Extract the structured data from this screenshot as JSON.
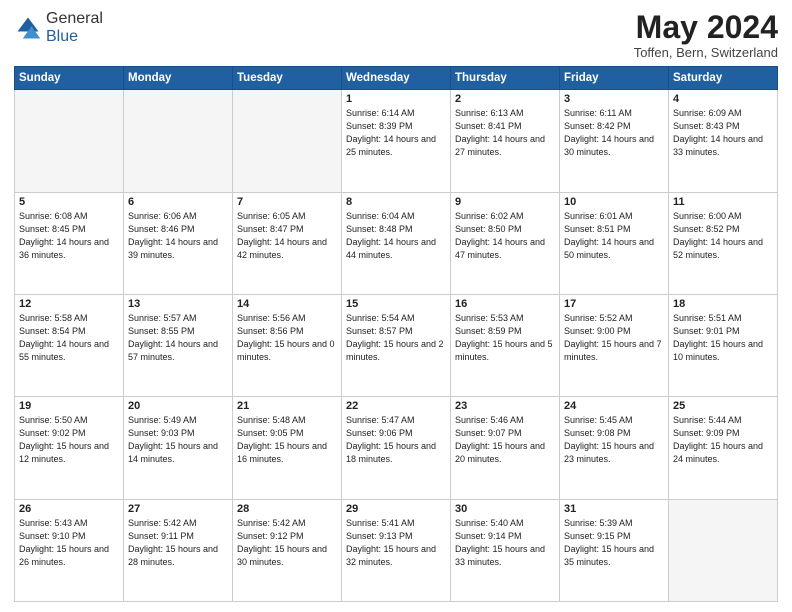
{
  "header": {
    "logo_general": "General",
    "logo_blue": "Blue",
    "month_title": "May 2024",
    "subtitle": "Toffen, Bern, Switzerland"
  },
  "weekdays": [
    "Sunday",
    "Monday",
    "Tuesday",
    "Wednesday",
    "Thursday",
    "Friday",
    "Saturday"
  ],
  "weeks": [
    [
      {
        "day": "",
        "empty": true
      },
      {
        "day": "",
        "empty": true
      },
      {
        "day": "",
        "empty": true
      },
      {
        "day": "1",
        "sunrise": "6:14 AM",
        "sunset": "8:39 PM",
        "daylight": "14 hours and 25 minutes."
      },
      {
        "day": "2",
        "sunrise": "6:13 AM",
        "sunset": "8:41 PM",
        "daylight": "14 hours and 27 minutes."
      },
      {
        "day": "3",
        "sunrise": "6:11 AM",
        "sunset": "8:42 PM",
        "daylight": "14 hours and 30 minutes."
      },
      {
        "day": "4",
        "sunrise": "6:09 AM",
        "sunset": "8:43 PM",
        "daylight": "14 hours and 33 minutes."
      }
    ],
    [
      {
        "day": "5",
        "sunrise": "6:08 AM",
        "sunset": "8:45 PM",
        "daylight": "14 hours and 36 minutes."
      },
      {
        "day": "6",
        "sunrise": "6:06 AM",
        "sunset": "8:46 PM",
        "daylight": "14 hours and 39 minutes."
      },
      {
        "day": "7",
        "sunrise": "6:05 AM",
        "sunset": "8:47 PM",
        "daylight": "14 hours and 42 minutes."
      },
      {
        "day": "8",
        "sunrise": "6:04 AM",
        "sunset": "8:48 PM",
        "daylight": "14 hours and 44 minutes."
      },
      {
        "day": "9",
        "sunrise": "6:02 AM",
        "sunset": "8:50 PM",
        "daylight": "14 hours and 47 minutes."
      },
      {
        "day": "10",
        "sunrise": "6:01 AM",
        "sunset": "8:51 PM",
        "daylight": "14 hours and 50 minutes."
      },
      {
        "day": "11",
        "sunrise": "6:00 AM",
        "sunset": "8:52 PM",
        "daylight": "14 hours and 52 minutes."
      }
    ],
    [
      {
        "day": "12",
        "sunrise": "5:58 AM",
        "sunset": "8:54 PM",
        "daylight": "14 hours and 55 minutes."
      },
      {
        "day": "13",
        "sunrise": "5:57 AM",
        "sunset": "8:55 PM",
        "daylight": "14 hours and 57 minutes."
      },
      {
        "day": "14",
        "sunrise": "5:56 AM",
        "sunset": "8:56 PM",
        "daylight": "15 hours and 0 minutes."
      },
      {
        "day": "15",
        "sunrise": "5:54 AM",
        "sunset": "8:57 PM",
        "daylight": "15 hours and 2 minutes."
      },
      {
        "day": "16",
        "sunrise": "5:53 AM",
        "sunset": "8:59 PM",
        "daylight": "15 hours and 5 minutes."
      },
      {
        "day": "17",
        "sunrise": "5:52 AM",
        "sunset": "9:00 PM",
        "daylight": "15 hours and 7 minutes."
      },
      {
        "day": "18",
        "sunrise": "5:51 AM",
        "sunset": "9:01 PM",
        "daylight": "15 hours and 10 minutes."
      }
    ],
    [
      {
        "day": "19",
        "sunrise": "5:50 AM",
        "sunset": "9:02 PM",
        "daylight": "15 hours and 12 minutes."
      },
      {
        "day": "20",
        "sunrise": "5:49 AM",
        "sunset": "9:03 PM",
        "daylight": "15 hours and 14 minutes."
      },
      {
        "day": "21",
        "sunrise": "5:48 AM",
        "sunset": "9:05 PM",
        "daylight": "15 hours and 16 minutes."
      },
      {
        "day": "22",
        "sunrise": "5:47 AM",
        "sunset": "9:06 PM",
        "daylight": "15 hours and 18 minutes."
      },
      {
        "day": "23",
        "sunrise": "5:46 AM",
        "sunset": "9:07 PM",
        "daylight": "15 hours and 20 minutes."
      },
      {
        "day": "24",
        "sunrise": "5:45 AM",
        "sunset": "9:08 PM",
        "daylight": "15 hours and 23 minutes."
      },
      {
        "day": "25",
        "sunrise": "5:44 AM",
        "sunset": "9:09 PM",
        "daylight": "15 hours and 24 minutes."
      }
    ],
    [
      {
        "day": "26",
        "sunrise": "5:43 AM",
        "sunset": "9:10 PM",
        "daylight": "15 hours and 26 minutes."
      },
      {
        "day": "27",
        "sunrise": "5:42 AM",
        "sunset": "9:11 PM",
        "daylight": "15 hours and 28 minutes."
      },
      {
        "day": "28",
        "sunrise": "5:42 AM",
        "sunset": "9:12 PM",
        "daylight": "15 hours and 30 minutes."
      },
      {
        "day": "29",
        "sunrise": "5:41 AM",
        "sunset": "9:13 PM",
        "daylight": "15 hours and 32 minutes."
      },
      {
        "day": "30",
        "sunrise": "5:40 AM",
        "sunset": "9:14 PM",
        "daylight": "15 hours and 33 minutes."
      },
      {
        "day": "31",
        "sunrise": "5:39 AM",
        "sunset": "9:15 PM",
        "daylight": "15 hours and 35 minutes."
      },
      {
        "day": "",
        "empty": true
      }
    ]
  ]
}
